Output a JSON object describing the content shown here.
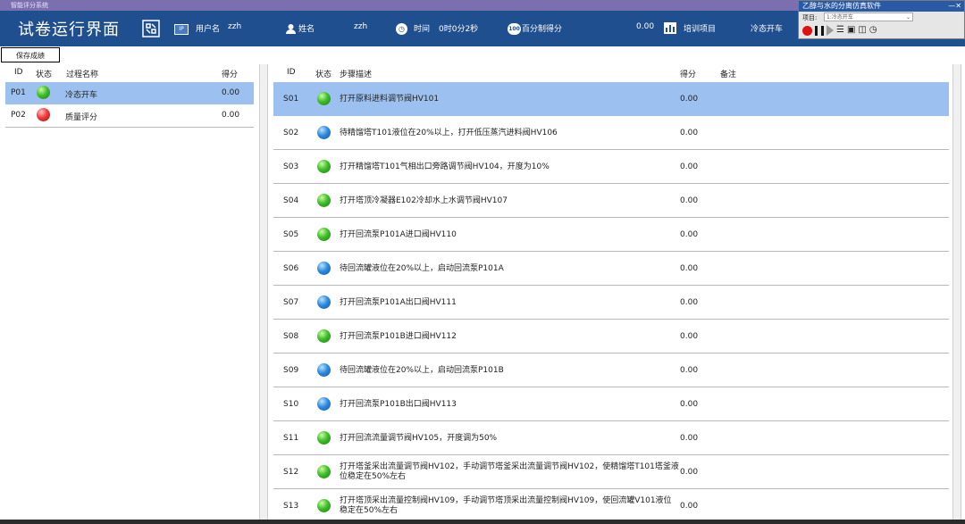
{
  "window": {
    "title": "智能评分系统"
  },
  "header": {
    "title": "试卷运行界面",
    "ip_badge": "IP",
    "username_label": "用户名",
    "username_value": "zzh",
    "name_label": "姓名",
    "name_value": "zzh",
    "time_label": "时间",
    "time_value": "0时0分2秒",
    "percent_badge": "100",
    "percent_label": "百分制得分",
    "percent_value": "0.00",
    "training_label": "培训项目",
    "training_value": "冷态开车"
  },
  "simulator": {
    "title": "乙醇与水的分离仿真软件",
    "window_controls": "—✕",
    "project_label": "项目:",
    "project_value": "1:冷态开车",
    "tools": [
      "record-icon",
      "pause-icon",
      "play-icon",
      "list-icon",
      "chart-icon",
      "camera-icon",
      "clock-icon"
    ]
  },
  "save_button": "保存成绩",
  "process_table": {
    "headers": {
      "id": "ID",
      "status": "状态",
      "name": "过程名称",
      "score": "得分"
    },
    "rows": [
      {
        "id": "P01",
        "status": "green",
        "name": "冷态开车",
        "score": "0.00"
      },
      {
        "id": "P02",
        "status": "red",
        "name": "质量评分",
        "score": "0.00"
      }
    ]
  },
  "step_table": {
    "headers": {
      "id": "ID",
      "status": "状态",
      "desc": "步骤描述",
      "score": "得分",
      "note": "备注"
    },
    "rows": [
      {
        "id": "S01",
        "status": "green",
        "desc": "打开原料进料调节阀HV101",
        "score": "0.00"
      },
      {
        "id": "S02",
        "status": "blue",
        "desc": "待精馏塔T101液位在20%以上，打开低压蒸汽进料阀HV106",
        "score": "0.00"
      },
      {
        "id": "S03",
        "status": "green",
        "desc": "打开精馏塔T101气相出口旁路调节阀HV104，开度为10%",
        "score": "0.00"
      },
      {
        "id": "S04",
        "status": "green",
        "desc": "打开塔顶冷凝器E102冷却水上水调节阀HV107",
        "score": "0.00"
      },
      {
        "id": "S05",
        "status": "green",
        "desc": "打开回流泵P101A进口阀HV110",
        "score": "0.00"
      },
      {
        "id": "S06",
        "status": "blue",
        "desc": "待回流罐液位在20%以上，启动回流泵P101A",
        "score": "0.00"
      },
      {
        "id": "S07",
        "status": "blue",
        "desc": "打开回流泵P101A出口阀HV111",
        "score": "0.00"
      },
      {
        "id": "S08",
        "status": "green",
        "desc": "打开回流泵P101B进口阀HV112",
        "score": "0.00"
      },
      {
        "id": "S09",
        "status": "blue",
        "desc": "待回流罐液位在20%以上，启动回流泵P101B",
        "score": "0.00"
      },
      {
        "id": "S10",
        "status": "blue",
        "desc": "打开回流泵P101B出口阀HV113",
        "score": "0.00"
      },
      {
        "id": "S11",
        "status": "green",
        "desc": "打开回流流量调节阀HV105，开度调为50%",
        "score": "0.00"
      },
      {
        "id": "S12",
        "status": "green",
        "desc": "打开塔釜采出流量调节阀HV102，手动调节塔釜采出流量调节阀HV102，使精馏塔T101塔釜液位稳定在50%左右",
        "score": "0.00"
      },
      {
        "id": "S13",
        "status": "green",
        "desc": "打开塔顶采出流量控制阀HV109，手动调节塔顶采出流量控制阀HV109，使回流罐V101液位稳定在50%左右",
        "score": "0.00"
      }
    ]
  }
}
